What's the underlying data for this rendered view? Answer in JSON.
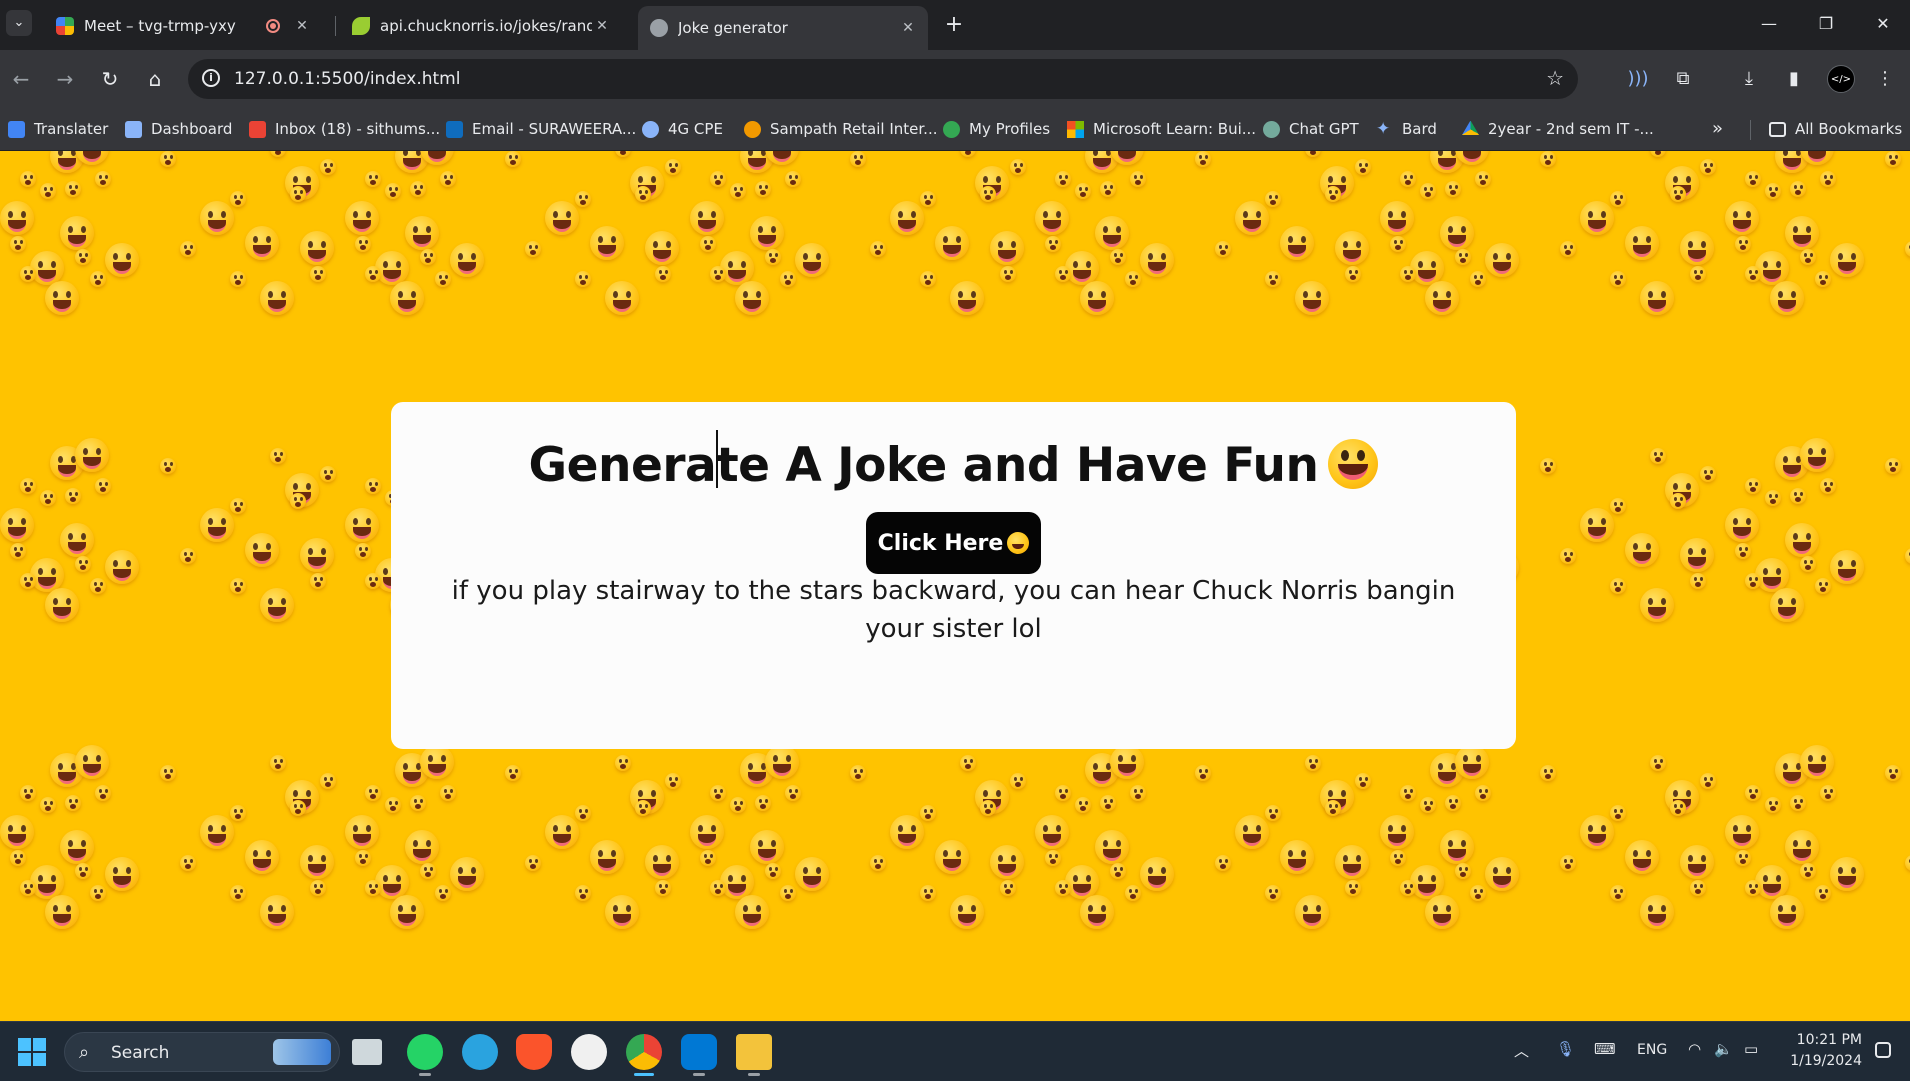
{
  "browser": {
    "tabs": [
      {
        "title": "Meet – tvg-trmp-yxy",
        "icon": "google-meet-icon",
        "recording": true
      },
      {
        "title": "api.chucknorris.io/jokes/random",
        "icon": "chucknorris-leaf-icon"
      },
      {
        "title": "Joke generator",
        "icon": "globe-icon",
        "active": true
      }
    ],
    "new_tab_label": "+",
    "address_bar": {
      "url": "127.0.0.1:5500/index.html"
    },
    "bookmarks": [
      {
        "label": "Translater",
        "icon": "google-translate-icon",
        "color": "#4285f4"
      },
      {
        "label": "Dashboard",
        "icon": "dashboard-icon",
        "color": "#8ab4f8"
      },
      {
        "label": "Inbox (18) - sithums...",
        "icon": "gmail-icon",
        "color": "#ea4335"
      },
      {
        "label": "Email - SURAWEERA...",
        "icon": "outlook-icon",
        "color": "#0f6cbd"
      },
      {
        "label": "4G CPE",
        "icon": "router-icon",
        "color": "#8ab4f8"
      },
      {
        "label": "Sampath Retail Inter...",
        "icon": "sampath-bank-icon",
        "color": "#f29900"
      },
      {
        "label": "My Profiles",
        "icon": "leaf-profiles-icon",
        "color": "#34a853"
      },
      {
        "label": "Microsoft Learn: Bui...",
        "icon": "microsoft-icon",
        "color": "#f25022"
      },
      {
        "label": "Chat GPT",
        "icon": "chatgpt-icon",
        "color": "#74aa9c"
      },
      {
        "label": "Bard",
        "icon": "bard-sparkle-icon",
        "color": "#8ab4f8"
      },
      {
        "label": "2year - 2nd sem IT -...",
        "icon": "google-drive-icon",
        "color": "#fbbc04"
      }
    ],
    "all_bookmarks_label": "All Bookmarks"
  },
  "page": {
    "background_color": "#ffc300",
    "title": "Generate A Joke and Have Fun",
    "button_label": "Click Here",
    "joke": "if you play stairway to the stars backward, you can hear Chuck Norris bangin your sister lol"
  },
  "taskbar": {
    "search_label": "Search",
    "apps": [
      "file-explorer-view-icon",
      "whatsapp-icon",
      "telegram-icon",
      "brave-icon",
      "github-icon",
      "chrome-icon",
      "vscode-icon",
      "file-explorer-icon"
    ],
    "language": "ENG",
    "time": "10:21 PM",
    "date": "1/19/2024"
  }
}
